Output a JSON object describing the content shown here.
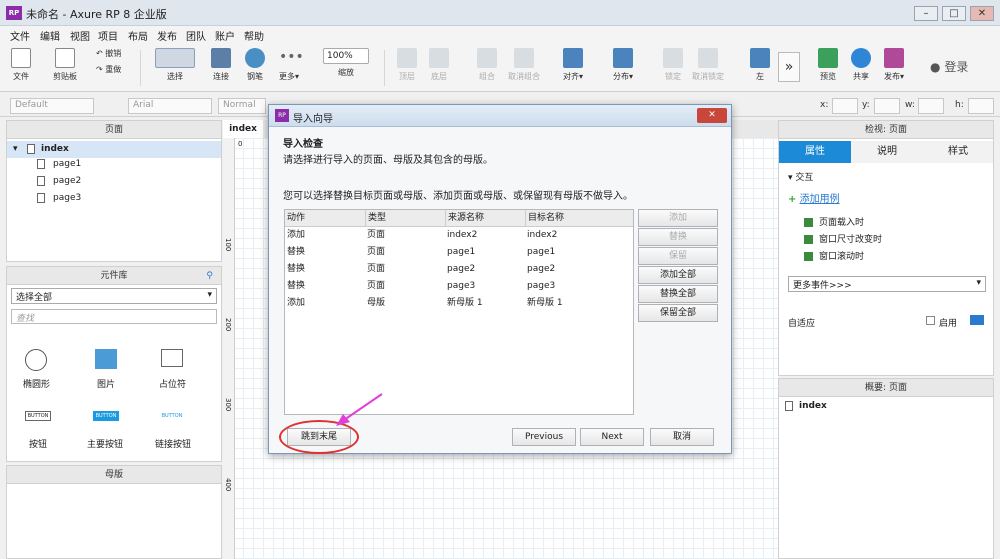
{
  "window": {
    "title": "未命名 - Axure RP 8 企业版",
    "logo": "RP"
  },
  "menu": [
    "文件",
    "编辑",
    "视图",
    "项目",
    "布局",
    "发布",
    "团队",
    "账户",
    "帮助"
  ],
  "toolbar": {
    "items": [
      {
        "label": "文件",
        "icon": "file-icon"
      },
      {
        "label": "剪贴板",
        "icon": "clipboard-icon"
      },
      {
        "label": "撤销",
        "icon": "undo-icon"
      },
      {
        "label": "重做",
        "icon": "redo-icon"
      },
      {
        "label": "选择",
        "icon": "select-icon"
      },
      {
        "label": "连接",
        "icon": "connect-icon"
      },
      {
        "label": "钢笔",
        "icon": "pen-icon"
      },
      {
        "label": "更多▾",
        "icon": "more-icon"
      },
      {
        "label": "缩放",
        "icon": "zoom-icon"
      },
      {
        "label": "顶层",
        "icon": "top-icon"
      },
      {
        "label": "底层",
        "icon": "bottom-icon"
      },
      {
        "label": "组合",
        "icon": "group-icon"
      },
      {
        "label": "取消组合",
        "icon": "ungroup-icon"
      },
      {
        "label": "对齐▾",
        "icon": "align-icon"
      },
      {
        "label": "分布▾",
        "icon": "distribute-icon"
      },
      {
        "label": "锁定",
        "icon": "lock-icon"
      },
      {
        "label": "取消锁定",
        "icon": "unlock-icon"
      },
      {
        "label": "左",
        "icon": "left-icon"
      },
      {
        "label": "预览",
        "icon": "preview-icon"
      },
      {
        "label": "共享",
        "icon": "share-icon"
      },
      {
        "label": "发布▾",
        "icon": "publish-icon"
      }
    ],
    "zoom": "100%",
    "login": "登录"
  },
  "formatbar": {
    "style": "Default",
    "font": "Arial",
    "weight": "Normal",
    "x_label": "x:",
    "y_label": "y:",
    "w_label": "w:",
    "h_label": "h:"
  },
  "pages_panel": {
    "title": "页面",
    "root": "index",
    "children": [
      "page1",
      "page2",
      "page3"
    ]
  },
  "library_panel": {
    "title": "元件库",
    "select": "选择全部",
    "search_placeholder": "查找",
    "widgets": [
      "椭圆形",
      "图片",
      "占位符",
      "按钮",
      "主要按钮",
      "链接按钮"
    ],
    "button_text": "BUTTON"
  },
  "masters_panel": {
    "title": "母版"
  },
  "canvas": {
    "tab": "index",
    "ruler_h": [
      "0"
    ],
    "ruler_v": [
      "100",
      "200",
      "300",
      "400"
    ]
  },
  "inspector": {
    "title": "检视: 页面",
    "tabs": [
      "属性",
      "说明",
      "样式"
    ],
    "interaction": "交互",
    "add_case": "添加用例",
    "events": [
      "页面载入时",
      "窗口尺寸改变时",
      "窗口滚动时"
    ],
    "more_events": "更多事件>>>",
    "adaptive": "自适应",
    "enable": "启用"
  },
  "outline": {
    "title": "概要: 页面",
    "item": "index"
  },
  "dialog": {
    "title": "导入向导",
    "heading": "导入检查",
    "subtitle": "请选择进行导入的页面、母版及其包含的母版。",
    "desc": "您可以选择替换目标页面或母版、添加页面或母版、或保留现有母版不做导入。",
    "columns": [
      "动作",
      "类型",
      "来源名称",
      "目标名称"
    ],
    "rows": [
      [
        "添加",
        "页面",
        "index2",
        "index2"
      ],
      [
        "替换",
        "页面",
        "page1",
        "page1"
      ],
      [
        "替换",
        "页面",
        "page2",
        "page2"
      ],
      [
        "替换",
        "页面",
        "page3",
        "page3"
      ],
      [
        "添加",
        "母版",
        "新母版 1",
        "新母版 1"
      ]
    ],
    "side_buttons": [
      "添加",
      "替换",
      "保留",
      "添加全部",
      "替换全部",
      "保留全部"
    ],
    "jump": "跳到末尾",
    "previous": "Previous",
    "next": "Next",
    "cancel": "取消",
    "close": "✕"
  }
}
